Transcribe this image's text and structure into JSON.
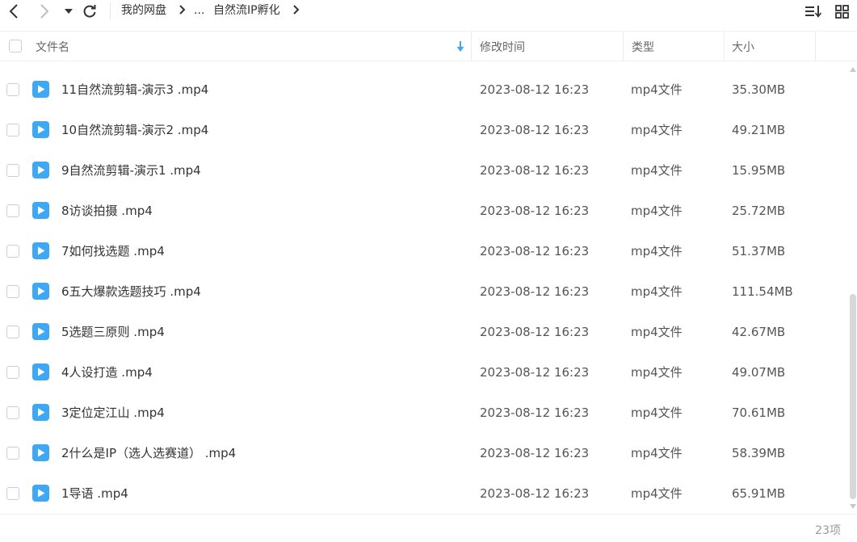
{
  "toolbar": {
    "breadcrumb": [
      {
        "label": "我的网盘"
      },
      {
        "label": "..."
      },
      {
        "label": "自然流IP孵化"
      }
    ]
  },
  "columns": {
    "name": "文件名",
    "modified": "修改时间",
    "type": "类型",
    "size": "大小"
  },
  "sort": {
    "column": "name",
    "direction": "descending"
  },
  "files": [
    {
      "name": "11自然流剪辑-演示3 .mp4",
      "modified": "2023-08-12 16:23",
      "type": "mp4文件",
      "size": "35.30MB"
    },
    {
      "name": "10自然流剪辑-演示2 .mp4",
      "modified": "2023-08-12 16:23",
      "type": "mp4文件",
      "size": "49.21MB"
    },
    {
      "name": "9自然流剪辑-演示1 .mp4",
      "modified": "2023-08-12 16:23",
      "type": "mp4文件",
      "size": "15.95MB"
    },
    {
      "name": "8访谈拍摄 .mp4",
      "modified": "2023-08-12 16:23",
      "type": "mp4文件",
      "size": "25.72MB"
    },
    {
      "name": "7如何找选题 .mp4",
      "modified": "2023-08-12 16:23",
      "type": "mp4文件",
      "size": "51.37MB"
    },
    {
      "name": "6五大爆款选题技巧 .mp4",
      "modified": "2023-08-12 16:23",
      "type": "mp4文件",
      "size": "111.54MB"
    },
    {
      "name": "5选题三原则 .mp4",
      "modified": "2023-08-12 16:23",
      "type": "mp4文件",
      "size": "42.67MB"
    },
    {
      "name": "4人设打造 .mp4",
      "modified": "2023-08-12 16:23",
      "type": "mp4文件",
      "size": "49.07MB"
    },
    {
      "name": "3定位定江山 .mp4",
      "modified": "2023-08-12 16:23",
      "type": "mp4文件",
      "size": "70.61MB"
    },
    {
      "name": "2什么是IP（选人选赛道） .mp4",
      "modified": "2023-08-12 16:23",
      "type": "mp4文件",
      "size": "58.39MB"
    },
    {
      "name": "1导语 .mp4",
      "modified": "2023-08-12 16:23",
      "type": "mp4文件",
      "size": "65.91MB"
    }
  ],
  "footer": {
    "count": "23项"
  },
  "colors": {
    "accent": "#3ea8f5",
    "text": "#333333",
    "muted": "#999999"
  },
  "icons": [
    "back-icon",
    "forward-icon",
    "history-dropdown-icon",
    "refresh-icon",
    "sort-menu-icon",
    "grid-view-icon",
    "video-file-icon"
  ]
}
